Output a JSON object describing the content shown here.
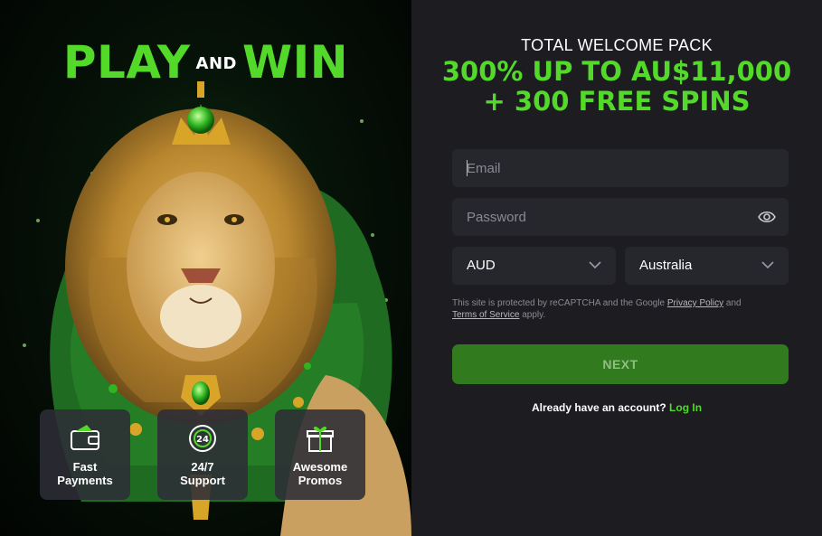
{
  "hero": {
    "play": "PLAY",
    "and": "AND",
    "win": "WIN"
  },
  "features": [
    {
      "icon": "wallet-icon",
      "line1": "Fast",
      "line2": "Payments"
    },
    {
      "icon": "24-7-support-icon",
      "line1": "24/7",
      "line2": "Support"
    },
    {
      "icon": "gift-icon",
      "line1": "Awesome",
      "line2": "Promos"
    }
  ],
  "promo": {
    "title": "TOTAL WELCOME PACK",
    "line1": "300% UP TO AU$11,000",
    "line2": "+ 300 FREE SPINS"
  },
  "form": {
    "email_placeholder": "Email",
    "password_placeholder": "Password",
    "currency": "AUD",
    "country": "Australia",
    "legal_prefix": "This site is protected by reCAPTCHA and the Google ",
    "privacy_link": "Privacy Policy",
    "legal_and": " and",
    "terms_link": "Terms of Service",
    "legal_suffix": " apply.",
    "next_label": "NEXT",
    "account_prompt": "Already have an account?",
    "login_link": "Log In"
  },
  "colors": {
    "accent_green": "#53d92a",
    "button_green": "#317a1e",
    "panel_dark": "#1c1c21",
    "field_bg": "#26262d"
  }
}
